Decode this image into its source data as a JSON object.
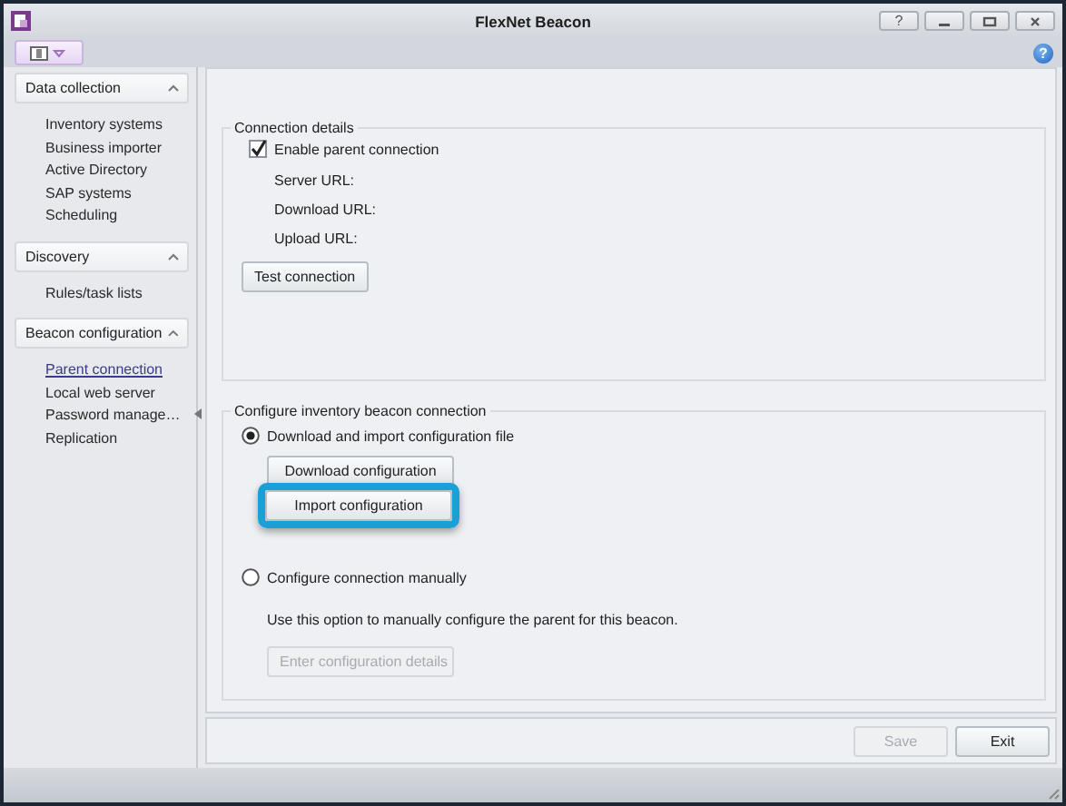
{
  "window": {
    "title": "FlexNet Beacon",
    "help_button": "?"
  },
  "toolbar": {
    "help": "?"
  },
  "sidebar": {
    "sections": [
      {
        "title": "Data collection",
        "expanded": true,
        "items": [
          {
            "label": "Inventory systems",
            "selected": false
          },
          {
            "label": "Business importer",
            "selected": false
          },
          {
            "label": "Active Directory",
            "selected": false
          },
          {
            "label": "SAP systems",
            "selected": false
          },
          {
            "label": "Scheduling",
            "selected": false
          }
        ]
      },
      {
        "title": "Discovery",
        "expanded": true,
        "items": [
          {
            "label": "Rules/task lists",
            "selected": false
          }
        ]
      },
      {
        "title": "Beacon configuration",
        "expanded": true,
        "items": [
          {
            "label": "Parent connection",
            "selected": true
          },
          {
            "label": "Local web server",
            "selected": false
          },
          {
            "label": "Password manage…",
            "selected": false
          },
          {
            "label": "Replication",
            "selected": false
          }
        ]
      }
    ]
  },
  "connection_details": {
    "title": "Connection details",
    "enable_parent": {
      "label": "Enable parent connection",
      "checked": true
    },
    "fields": [
      "Server URL:",
      "Download URL:",
      "Upload URL:"
    ],
    "test_button": "Test connection"
  },
  "configure": {
    "title": "Configure inventory beacon connection",
    "options": [
      {
        "label": "Download and import configuration file",
        "selected": true,
        "buttons": [
          {
            "label": "Download configuration",
            "disabled": false,
            "highlighted": false
          },
          {
            "label": "Import configuration",
            "disabled": false,
            "highlighted": true
          }
        ]
      },
      {
        "label": "Configure connection manually",
        "selected": false,
        "description": "Use this option to manually configure the parent for this beacon.",
        "buttons": [
          {
            "label": "Enter configuration details",
            "disabled": true,
            "highlighted": false
          }
        ]
      }
    ]
  },
  "footer": {
    "buttons": [
      {
        "label": "Save",
        "disabled": true
      },
      {
        "label": "Exit",
        "disabled": false
      }
    ]
  }
}
